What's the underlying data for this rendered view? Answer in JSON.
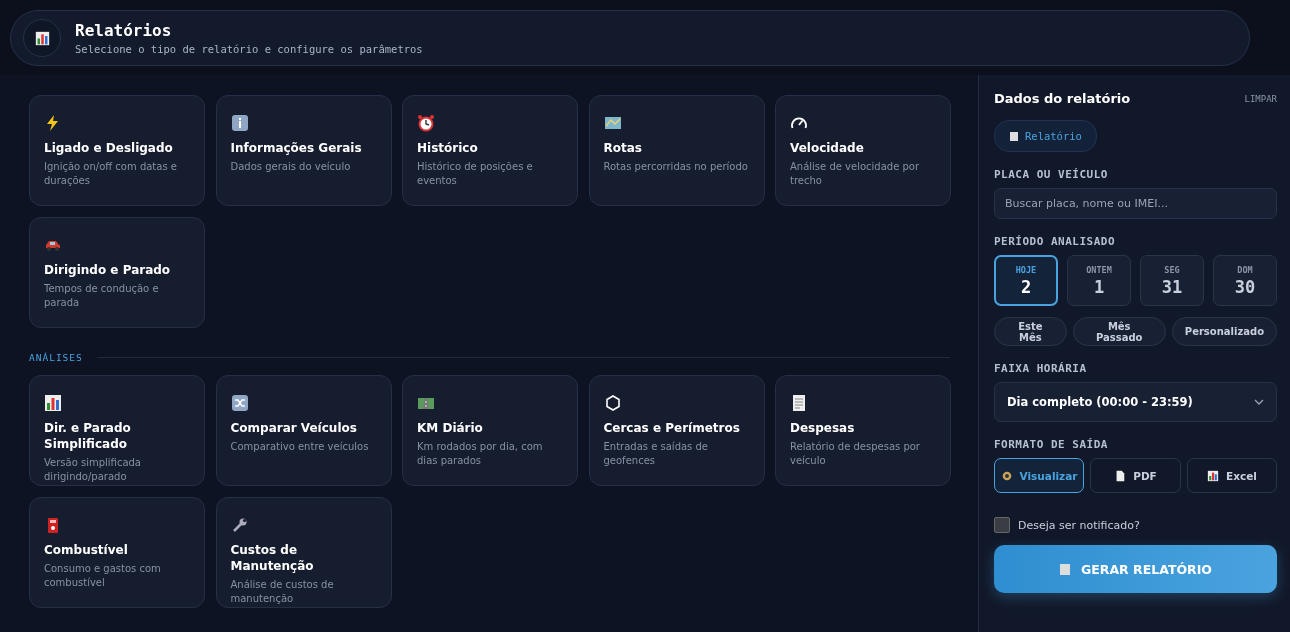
{
  "header": {
    "title": "Relatórios",
    "subtitle": "Selecione o tipo de relatório e configure os parâmetros"
  },
  "sections": [
    {
      "items": [
        {
          "title": "Ligado e Desligado",
          "description": "Ignição on/off com datas e durações"
        },
        {
          "title": "Informações Gerais",
          "description": "Dados gerais do veículo"
        },
        {
          "title": "Histórico",
          "description": "Histórico de posições e eventos"
        },
        {
          "title": "Rotas",
          "description": "Rotas percorridas no período"
        },
        {
          "title": "Velocidade",
          "description": "Análise de velocidade por trecho"
        },
        {
          "title": "Dirigindo e Parado",
          "description": "Tempos de condução e parada"
        }
      ]
    },
    {
      "title": "ANÁLISES",
      "items": [
        {
          "title": "Dir. e Parado Simplificado",
          "description": "Versão simplificada dirigindo/parado"
        },
        {
          "title": "Comparar Veículos",
          "description": "Comparativo entre veículos"
        },
        {
          "title": "KM Diário",
          "description": "Km rodados por dia, com dias parados"
        },
        {
          "title": "Cercas e Perímetros",
          "description": "Entradas e saídas de geofences"
        },
        {
          "title": "Despesas",
          "description": "Relatório de despesas por veículo"
        },
        {
          "title": "Combustível",
          "description": "Consumo e gastos com combustível"
        },
        {
          "title": "Custos de Manutenção",
          "description": "Análise de custos de manutenção"
        }
      ]
    }
  ],
  "panel": {
    "title": "Dados do relatório",
    "clear": "LIMPAR",
    "chip": "Relatório",
    "vehicle_label": "PLACA OU VEÍCULO",
    "vehicle_placeholder": "Buscar placa, nome ou IMEI...",
    "period_label": "PERÍODO ANALISADO",
    "days": [
      {
        "label": "HOJE",
        "number": "2",
        "selected": true
      },
      {
        "label": "ONTEM",
        "number": "1",
        "selected": false
      },
      {
        "label": "SEG",
        "number": "31",
        "selected": false
      },
      {
        "label": "DOM",
        "number": "30",
        "selected": false
      }
    ],
    "ranges": [
      {
        "label": "Este Mês",
        "selected": false
      },
      {
        "label": "Mês Passado",
        "selected": false
      },
      {
        "label": "Personalizado",
        "selected": false
      }
    ],
    "time_label": "FAIXA HORÁRIA",
    "time_value": "Dia completo (00:00 - 23:59)",
    "format_label": "FORMATO DE SAÍDA",
    "formats": [
      {
        "label": "Visualizar",
        "selected": true
      },
      {
        "label": "PDF",
        "selected": false
      },
      {
        "label": "Excel",
        "selected": false
      }
    ],
    "notify": {
      "label": "Deseja ser notificado?",
      "checked": false
    },
    "generate": "GERAR RELATÓRIO"
  }
}
